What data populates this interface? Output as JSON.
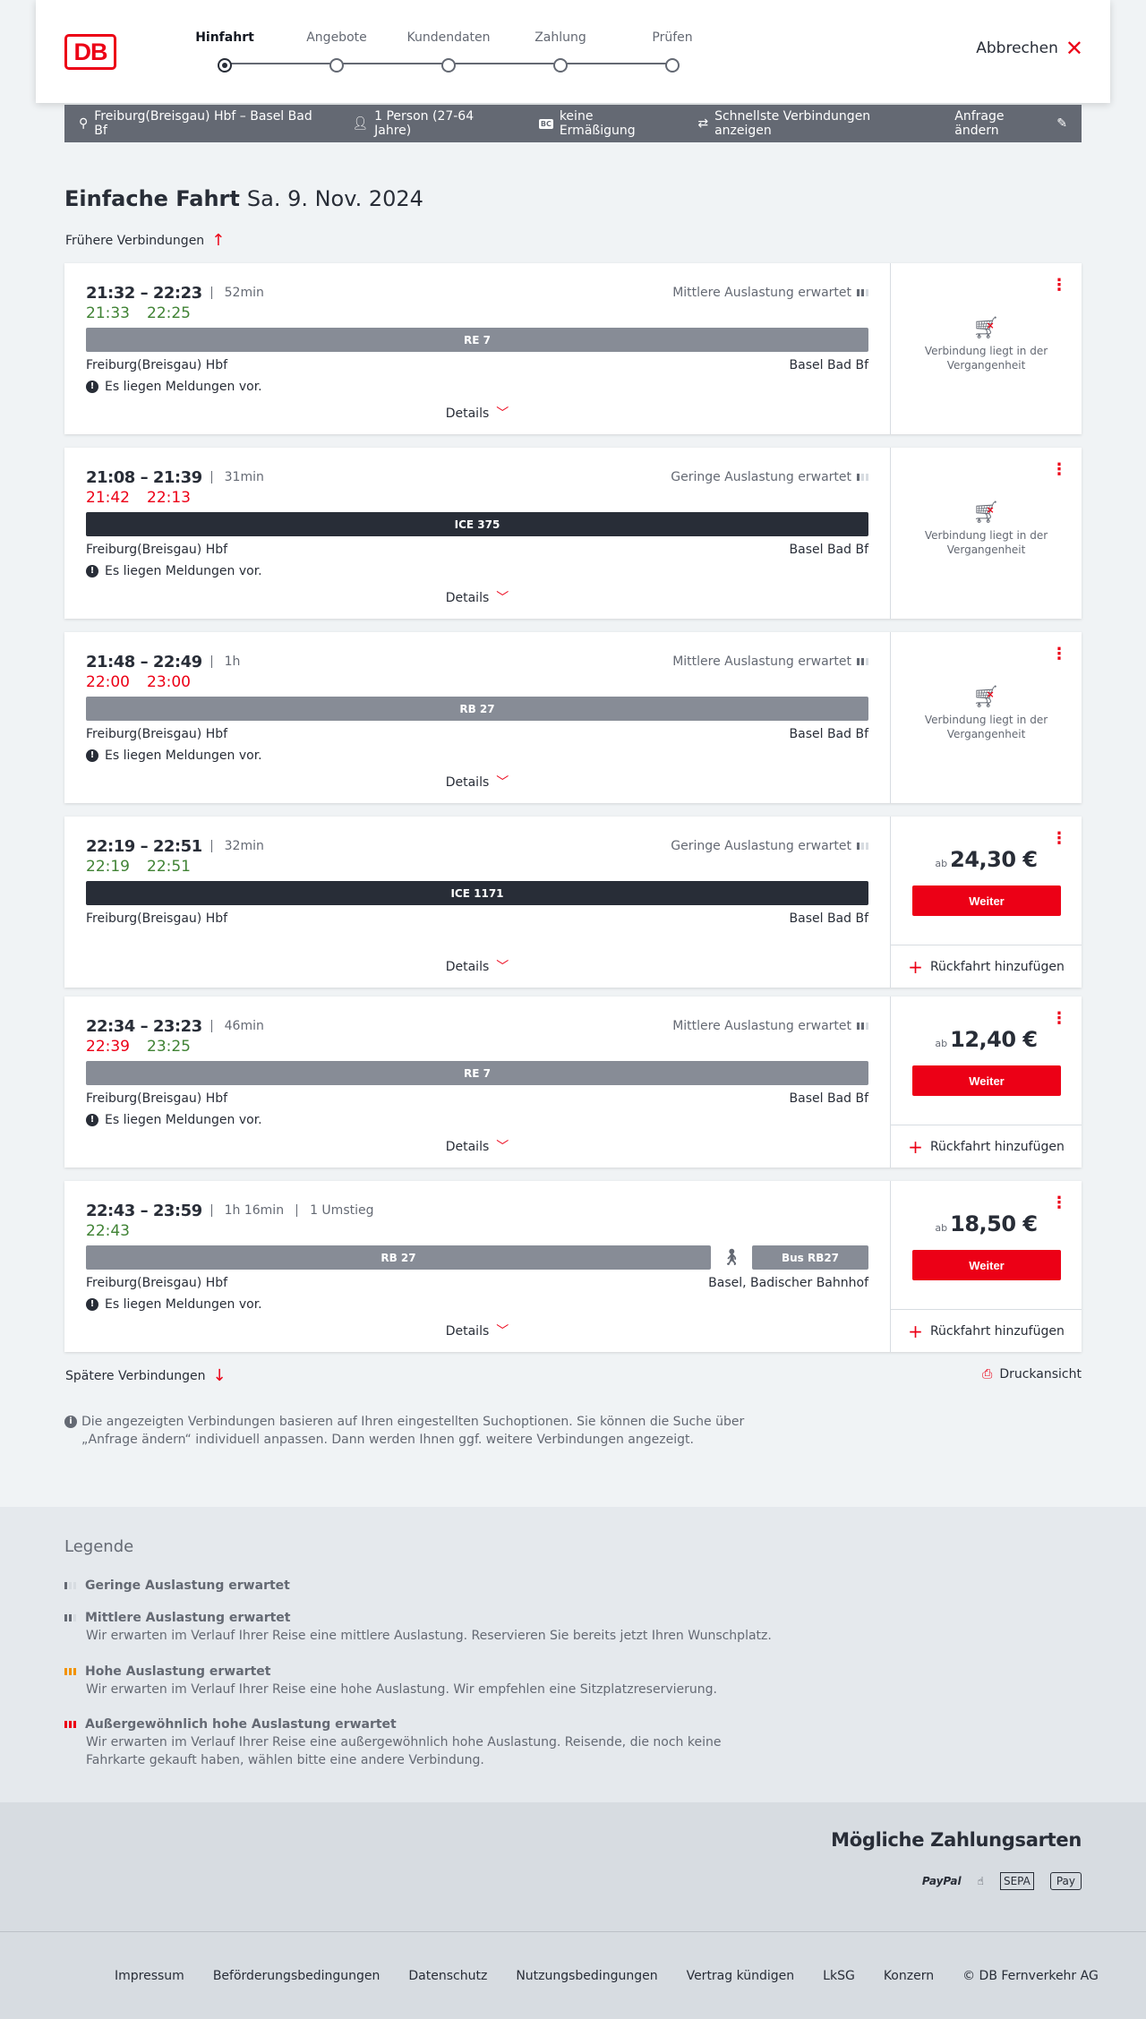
{
  "header": {
    "logo": "DB",
    "steps": [
      {
        "label": "Hinfahrt",
        "current": true
      },
      {
        "label": "Angebote",
        "current": false
      },
      {
        "label": "Kundendaten",
        "current": false
      },
      {
        "label": "Zahlung",
        "current": false
      },
      {
        "label": "Prüfen",
        "current": false
      }
    ],
    "cancel": "Abbrechen"
  },
  "query": {
    "route": "Freiburg(Breisgau) Hbf – Basel Bad Bf",
    "persons": "1 Person (27-64 Jahre)",
    "bc_badge": "BC",
    "discount": "keine Ermäßigung",
    "fastest": "Schnellste Verbindungen anzeigen",
    "change": "Anfrage ändern"
  },
  "title": {
    "type": "Einfache Fahrt",
    "date": "Sa. 9. Nov. 2024"
  },
  "earlier": "Frühere Verbindungen",
  "later": "Spätere Verbindungen",
  "print": "Druckansicht",
  "labels": {
    "details": "Details",
    "past": "Verbindung liegt in der Vergangenheit",
    "ab": "ab",
    "weiter": "Weiter",
    "rueckfahrt": "Rückfahrt hinzufügen",
    "messages": "Es liegen Meldungen vor."
  },
  "connections": [
    {
      "times": "21:32 – 22:23",
      "duration": "52min",
      "load": "Mittlere Auslastung erwartet",
      "load_level": 2,
      "rt_dep": "21:33",
      "rt_dep_color": "green",
      "rt_arr": "22:25",
      "rt_arr_color": "green",
      "trains": [
        {
          "name": "RE 7",
          "kind": "reg"
        }
      ],
      "from": "Freiburg(Breisgau) Hbf",
      "to": "Basel Bad Bf",
      "has_messages": true,
      "past": true
    },
    {
      "times": "21:08 – 21:39",
      "duration": "31min",
      "load": "Geringe Auslastung erwartet",
      "load_level": 1,
      "rt_dep": "21:42",
      "rt_dep_color": "red",
      "rt_arr": "22:13",
      "rt_arr_color": "red",
      "trains": [
        {
          "name": "ICE 375",
          "kind": "ice"
        }
      ],
      "from": "Freiburg(Breisgau) Hbf",
      "to": "Basel Bad Bf",
      "has_messages": true,
      "past": true
    },
    {
      "times": "21:48 – 22:49",
      "duration": "1h",
      "load": "Mittlere Auslastung erwartet",
      "load_level": 2,
      "rt_dep": "22:00",
      "rt_dep_color": "red",
      "rt_arr": "23:00",
      "rt_arr_color": "red",
      "trains": [
        {
          "name": "RB 27",
          "kind": "reg"
        }
      ],
      "from": "Freiburg(Breisgau) Hbf",
      "to": "Basel Bad Bf",
      "has_messages": true,
      "past": true
    },
    {
      "times": "22:19 – 22:51",
      "duration": "32min",
      "load": "Geringe Auslastung erwartet",
      "load_level": 1,
      "rt_dep": "22:19",
      "rt_dep_color": "green",
      "rt_arr": "22:51",
      "rt_arr_color": "green",
      "trains": [
        {
          "name": "ICE 1171",
          "kind": "ice"
        }
      ],
      "from": "Freiburg(Breisgau) Hbf",
      "to": "Basel Bad Bf",
      "has_messages": false,
      "past": false,
      "price": "24,30 €"
    },
    {
      "times": "22:34 – 23:23",
      "duration": "46min",
      "load": "Mittlere Auslastung erwartet",
      "load_level": 2,
      "rt_dep": "22:39",
      "rt_dep_color": "red",
      "rt_arr": "23:25",
      "rt_arr_color": "green",
      "trains": [
        {
          "name": "RE 7",
          "kind": "reg"
        }
      ],
      "from": "Freiburg(Breisgau) Hbf",
      "to": "Basel Bad Bf",
      "has_messages": true,
      "past": false,
      "price": "12,40 €"
    },
    {
      "times": "22:43 – 23:59",
      "duration": "1h 16min",
      "transfers": "1 Umstieg",
      "load": "",
      "load_level": 0,
      "rt_dep": "22:43",
      "rt_dep_color": "green",
      "rt_arr": "",
      "rt_arr_color": "green",
      "trains": [
        {
          "name": "RB 27",
          "kind": "reg"
        },
        {
          "name": "Bus RB27",
          "kind": "reg"
        }
      ],
      "walk": true,
      "from": "Freiburg(Breisgau) Hbf",
      "to": "Basel, Badischer Bahnhof",
      "has_messages": true,
      "past": false,
      "price": "18,50 €"
    }
  ],
  "info": "Die angezeigten Verbindungen basieren auf Ihren eingestellten Suchoptionen. Sie können die Suche über „Anfrage ändern“ individuell anpassen. Dann werden Ihnen ggf. weitere Verbindungen angezeigt.",
  "legend": {
    "title": "Legende",
    "items": [
      {
        "head": "Geringe Auslastung erwartet",
        "text": ""
      },
      {
        "head": "Mittlere Auslastung erwartet",
        "text": "Wir erwarten im Verlauf Ihrer Reise eine mittlere Auslastung. Reservieren Sie bereits jetzt Ihren Wunschplatz."
      },
      {
        "head": "Hohe Auslastung erwartet",
        "text": "Wir erwarten im Verlauf Ihrer Reise eine hohe Auslastung. Wir empfehlen eine Sitzplatzreservierung."
      },
      {
        "head": "Außergewöhnlich hohe Auslastung erwartet",
        "text": "Wir erwarten im Verlauf Ihrer Reise eine außergewöhnlich hohe Auslastung. Reisende, die noch keine Fahrkarte gekauft haben, wählen bitte eine andere Verbindung."
      }
    ]
  },
  "payment": {
    "title": "Mögliche Zahlungsarten",
    "methods": [
      "PayPal",
      "Pay"
    ],
    "sepa": "SEPA"
  },
  "footer": {
    "links": [
      "Impressum",
      "Beförderungsbedingungen",
      "Datenschutz",
      "Nutzungsbedingungen",
      "Vertrag kündigen",
      "LkSG",
      "Konzern",
      "© DB Fernverkehr AG"
    ]
  },
  "colors": {
    "db_red": "#ec0016",
    "punctual_green": "#408335",
    "delay_red": "#ec0016",
    "regional_bar": "#878c96",
    "ice_bar": "#282d37"
  }
}
